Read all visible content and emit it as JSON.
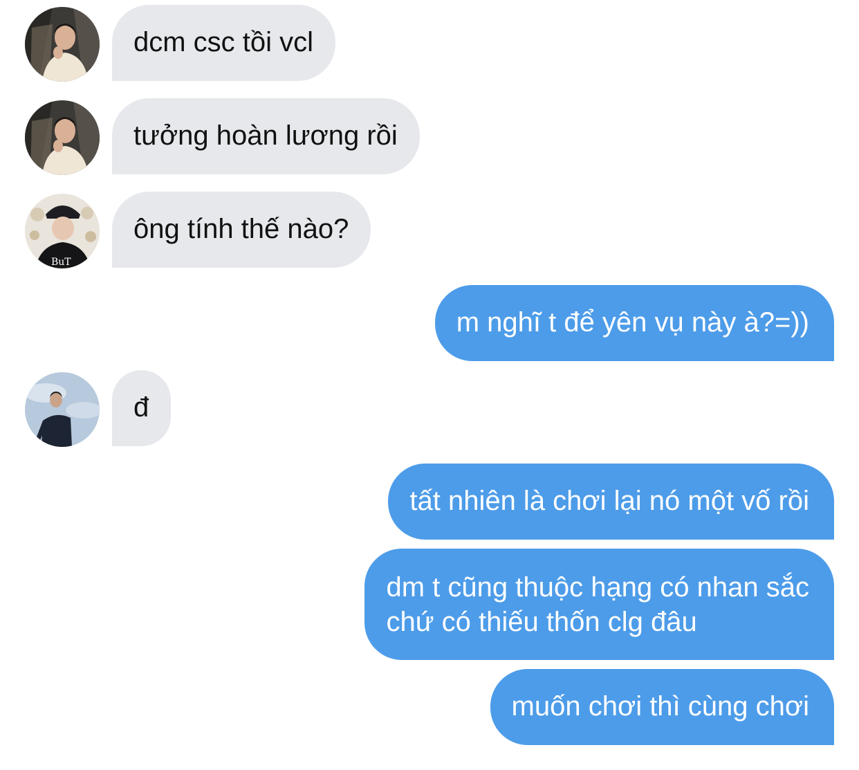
{
  "conversation": {
    "messages": [
      {
        "sender": "other",
        "avatar": "avatar-a",
        "text": "dcm csc tồi vcl"
      },
      {
        "sender": "other",
        "avatar": "avatar-a",
        "text": "tưởng hoàn lương rồi"
      },
      {
        "sender": "other",
        "avatar": "avatar-b",
        "text": "ông tính thế nào?"
      },
      {
        "sender": "me",
        "text": "m nghĩ t để yên vụ này à?=))"
      },
      {
        "sender": "other",
        "avatar": "avatar-c",
        "text": "đ"
      },
      {
        "sender": "me",
        "text": "tất nhiên là chơi lại nó một vố rồi"
      },
      {
        "sender": "me",
        "text_lines": [
          "dm t cũng thuộc hạng có nhan sắc",
          "chứ có thiếu thốn clg đâu"
        ]
      },
      {
        "sender": "me",
        "text": "muốn chơi thì cùng chơi"
      }
    ]
  },
  "colors": {
    "incoming_bubble": "#e6e8ec",
    "incoming_text": "#111111",
    "outgoing_bubble": "#4d9ce9",
    "outgoing_text": "#ffffff",
    "background": "#ffffff"
  },
  "avatar_badges": {
    "avatar_b_shirt_text": "BuT"
  }
}
